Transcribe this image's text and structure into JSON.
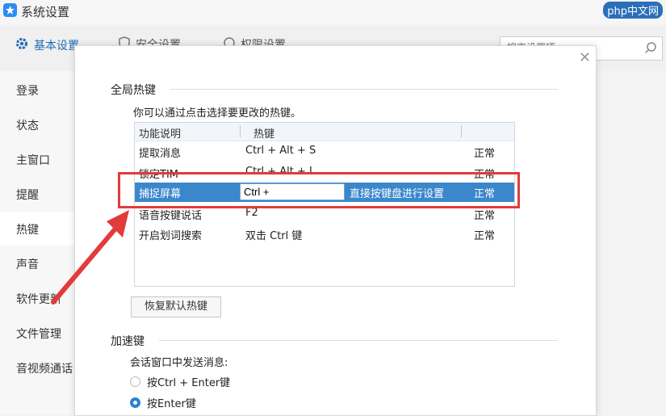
{
  "window": {
    "title": "系统设置",
    "watermark": "php中文网"
  },
  "topnav": {
    "tabs": [
      {
        "label": "基本设置"
      },
      {
        "label": "安全设置"
      },
      {
        "label": "权限设置"
      }
    ],
    "search_placeholder": "搜索设置项"
  },
  "sidebar": {
    "items": [
      {
        "label": "登录"
      },
      {
        "label": "状态"
      },
      {
        "label": "主窗口"
      },
      {
        "label": "提醒"
      },
      {
        "label": "热键"
      },
      {
        "label": "声音"
      },
      {
        "label": "软件更新"
      },
      {
        "label": "文件管理"
      },
      {
        "label": "音视频通话"
      }
    ],
    "active": "热键"
  },
  "dialog": {
    "global_hotkeys_title": "全局热键",
    "hint": "你可以通过点击选择要更改的热键。",
    "columns": [
      "功能说明",
      "热键"
    ],
    "rows": [
      {
        "func": "提取消息",
        "key": "Ctrl + Alt + S",
        "status": "正常"
      },
      {
        "func": "锁定TIM",
        "key": "Ctrl + Alt + L",
        "status": "正常"
      },
      {
        "func": "捕捉屏幕",
        "key": "Ctrl +",
        "note": "直接按键盘进行设置",
        "status": "正常"
      },
      {
        "func": "语音按键说话",
        "key": "F2",
        "status": "正常"
      },
      {
        "func": "开启划词搜索",
        "key": "双击 Ctrl 键",
        "status": "正常"
      }
    ],
    "restore_label": "恢复默认热键",
    "accel_title": "加速键",
    "send_label": "会话窗口中发送消息:",
    "radio_options": [
      {
        "label": "按Ctrl + Enter键",
        "checked": false
      },
      {
        "label": "按Enter键",
        "checked": true
      }
    ]
  },
  "colors": {
    "accent": "#3b87cc",
    "highlight": "#e23b3b"
  }
}
